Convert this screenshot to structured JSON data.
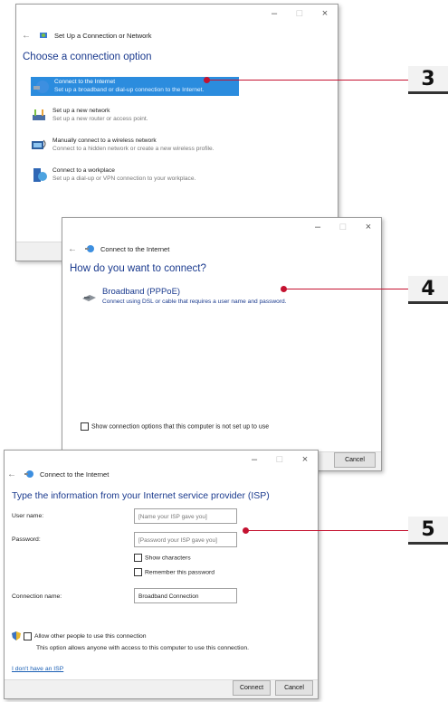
{
  "window1": {
    "title": "Set Up a Connection or Network",
    "heading": "Choose a connection option",
    "options": [
      {
        "title": "Connect to the Internet",
        "subtitle": "Set up a broadband or dial-up connection to the Internet."
      },
      {
        "title": "Set up a new network",
        "subtitle": "Set up a new router or access point."
      },
      {
        "title": "Manually connect to a wireless network",
        "subtitle": "Connect to a hidden network or create a new wireless profile."
      },
      {
        "title": "Connect to a workplace",
        "subtitle": "Set up a dial-up or VPN connection to your workplace."
      }
    ]
  },
  "window2": {
    "title": "Connect to the Internet",
    "heading": "How do you want to connect?",
    "option": {
      "title": "Broadband (PPPoE)",
      "subtitle": "Connect using DSL or cable that requires a user name and password."
    },
    "checkbox_label": "Show connection options that this computer is not set up to use",
    "cancel": "Cancel"
  },
  "window3": {
    "title": "Connect to the Internet",
    "heading": "Type the information from your Internet service provider (ISP)",
    "user_label": "User name:",
    "user_placeholder": "[Name your ISP gave you]",
    "password_label": "Password:",
    "password_placeholder": "[Password your ISP gave you]",
    "show_chars": "Show characters",
    "remember": "Remember this password",
    "conn_label": "Connection name:",
    "conn_value": "Broadband Connection",
    "allow": "Allow other people to use this connection",
    "allow_note": "This option allows anyone with access to this computer to use this connection.",
    "no_isp": "I don't have an ISP",
    "connect": "Connect",
    "cancel": "Cancel"
  },
  "titlebar": {
    "minimize": "–",
    "maximize": "□",
    "close": "×"
  },
  "callouts": [
    "3",
    "4",
    "5"
  ],
  "colors": {
    "accent": "#c41230",
    "heading": "#1a3a8e",
    "selection": "#2b8cde"
  }
}
